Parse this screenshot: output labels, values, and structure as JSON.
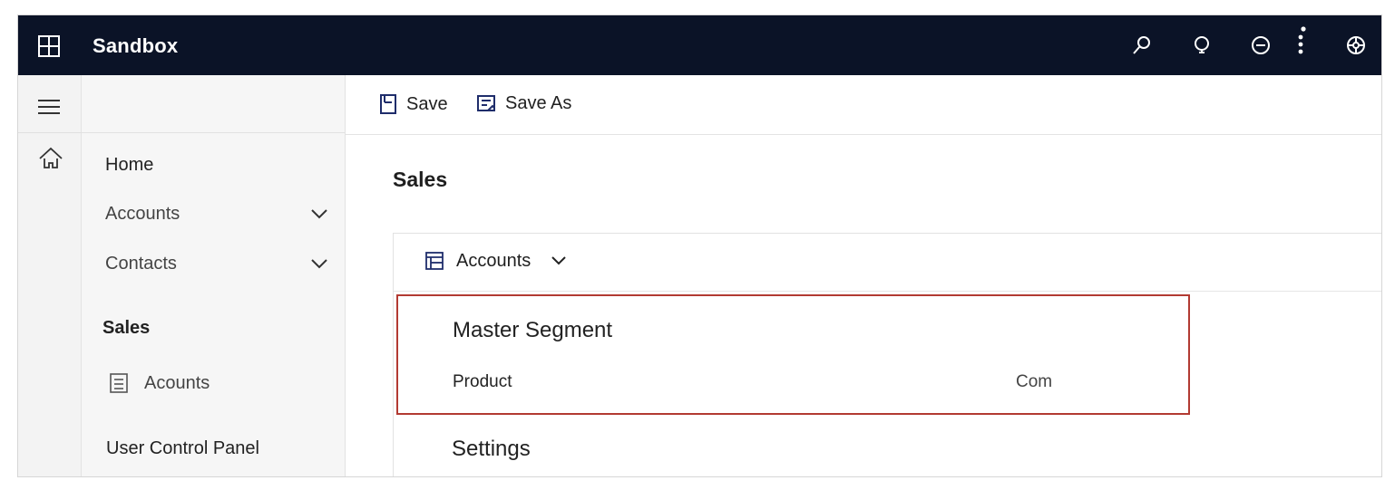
{
  "topbar": {
    "app_title": "Sandbox",
    "icons": [
      "waffle-icon",
      "search-icon",
      "lightbulb-icon",
      "minus-circle-icon",
      "more-vertical-icon",
      "settings-icon"
    ]
  },
  "rail": {
    "icons": [
      "hamburger-icon",
      "home-icon"
    ]
  },
  "sitemap": {
    "items": [
      {
        "label": "Home"
      },
      {
        "label": "Accounts"
      },
      {
        "label": "Contacts"
      },
      {
        "label": "Sales"
      },
      {
        "label": "Acounts"
      },
      {
        "label": "User Control Panel"
      }
    ]
  },
  "command_bar": {
    "save_label": "Save",
    "save_as_label": "Save As"
  },
  "main": {
    "page_title": "Sales",
    "panel": {
      "header_label": "Accounts",
      "segment_title": "Master Segment",
      "row_left": "Product",
      "row_right": "Com",
      "settings_label": "Settings"
    }
  },
  "colors": {
    "topbar_bg": "#0b1327",
    "highlight_border": "#b23a32",
    "accent_icon": "#1f2d6b"
  }
}
